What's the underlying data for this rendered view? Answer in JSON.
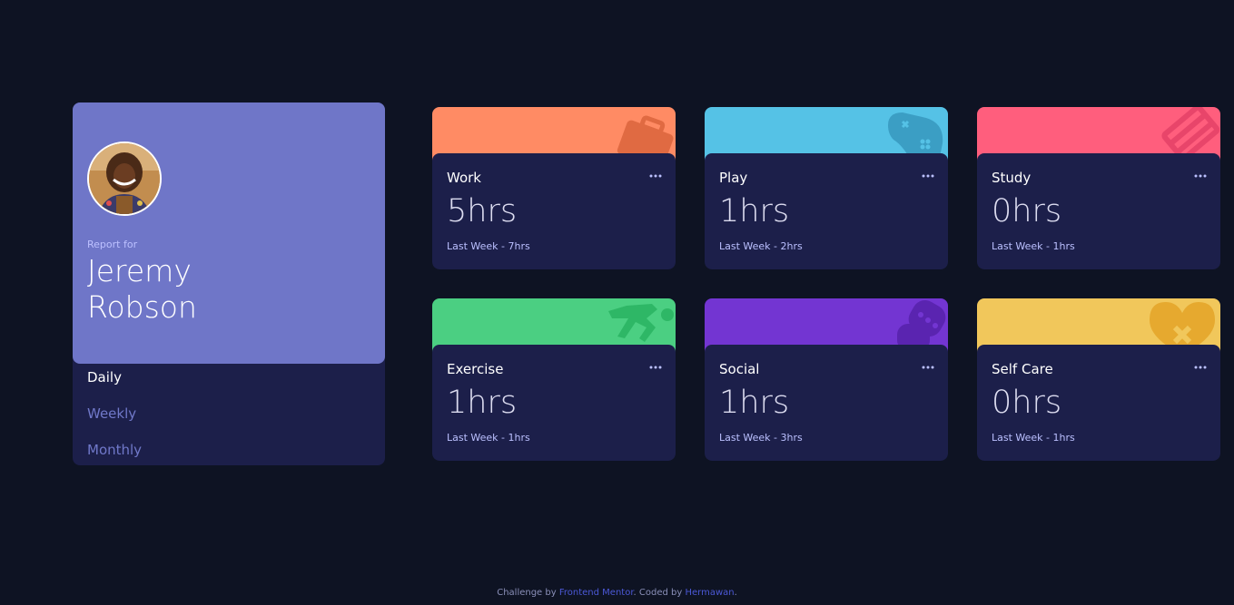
{
  "profile": {
    "report_for": "Report for",
    "name": "Jeremy Robson"
  },
  "periods": [
    "Daily",
    "Weekly",
    "Monthly"
  ],
  "selected_period": "Daily",
  "cards": [
    {
      "title": "Work",
      "current": "5hrs",
      "previous": "Last Week - 7hrs",
      "color": "#ff8b64",
      "icon": "briefcase-icon"
    },
    {
      "title": "Play",
      "current": "1hrs",
      "previous": "Last Week - 2hrs",
      "color": "#55c2e6",
      "icon": "gamepad-icon"
    },
    {
      "title": "Study",
      "current": "0hrs",
      "previous": "Last Week - 1hrs",
      "color": "#ff5e7d",
      "icon": "book-icon"
    },
    {
      "title": "Exercise",
      "current": "1hrs",
      "previous": "Last Week - 1hrs",
      "color": "#4bcf82",
      "icon": "running-icon"
    },
    {
      "title": "Social",
      "current": "1hrs",
      "previous": "Last Week - 3hrs",
      "color": "#7335d2",
      "icon": "speech-icon"
    },
    {
      "title": "Self Care",
      "current": "0hrs",
      "previous": "Last Week - 1hrs",
      "color": "#f1c75b",
      "icon": "heart-icon"
    }
  ],
  "footer": {
    "prefix": "Challenge by",
    "link1": "Frontend Mentor",
    "middle": ". Coded by",
    "link2": "Hermawan",
    "suffix": "."
  }
}
